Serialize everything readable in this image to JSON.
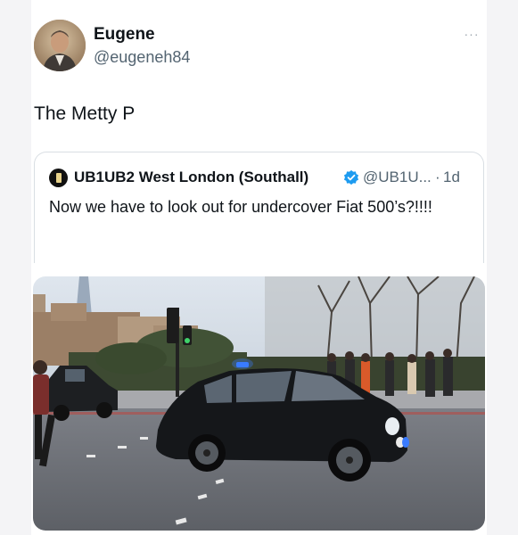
{
  "tweet": {
    "author_name": "Eugene",
    "author_handle": "@eugeneh84",
    "more_label": "···",
    "text": "The Metty P"
  },
  "quoted_tweet": {
    "author_name": "UB1UB2 West London (Southall)",
    "author_handle": "@UB1U...",
    "separator": "·",
    "time": "1d",
    "text": "Now we have to look out for undercover Fiat 500’s?!!!!"
  },
  "colors": {
    "verified_badge": "#1d9bf0",
    "secondary_text": "#536471",
    "primary_text": "#0f1419",
    "police_light": "#3a7bff"
  }
}
